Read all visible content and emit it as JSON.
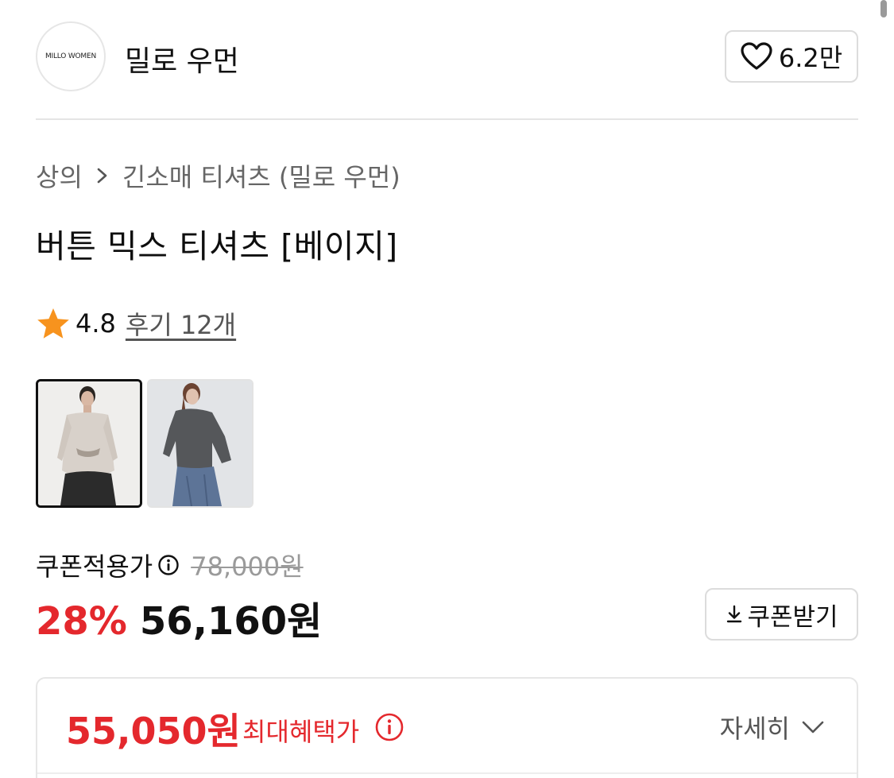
{
  "brand": {
    "logo_text": "MILLO WOMEN",
    "name": "밀로 우먼",
    "like_count": "6.2만"
  },
  "breadcrumb": {
    "category": "상의",
    "subcategory": "긴소매 티셔츠 (밀로 우먼)"
  },
  "product": {
    "title": "버튼 믹스 티셔츠 [베이지]",
    "rating": "4.8",
    "review_link": "후기 12개",
    "images": [
      {
        "name": "beige-model-photo",
        "selected": true
      },
      {
        "name": "charcoal-model-photo",
        "selected": false
      }
    ]
  },
  "price": {
    "coupon_label": "쿠폰적용가",
    "original_price": "78,000원",
    "discount_rate": "28%",
    "sale_price": "56,160원",
    "coupon_button_label": "쿠폰받기"
  },
  "benefit": {
    "max_price": "55,050원",
    "max_label": "최대혜택가",
    "detail_label": "자세히"
  },
  "colors": {
    "accent_red": "#e4282d",
    "star": "#f7931e",
    "border": "#dcdcdc",
    "muted_text": "#666666"
  },
  "icons": [
    "heart-icon",
    "chevron-right-icon",
    "star-icon",
    "info-icon",
    "download-icon",
    "chevron-down-icon"
  ]
}
